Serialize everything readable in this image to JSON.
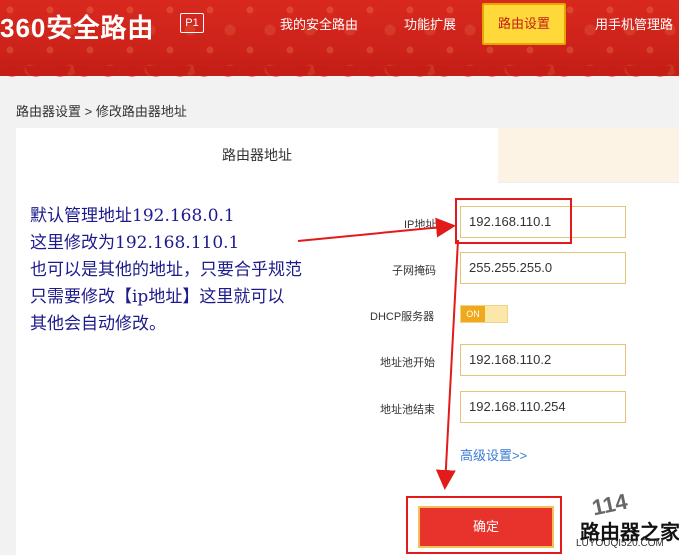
{
  "header": {
    "logo": "360安全路由",
    "badge": "P1",
    "nav": [
      "我的安全路由",
      "功能扩展",
      "路由设置",
      "用手机管理路"
    ],
    "active_index": 2
  },
  "breadcrumb": "路由器设置 > 修改路由器地址",
  "tab": {
    "title": "路由器地址"
  },
  "annotation": {
    "lines": [
      "默认管理地址192.168.0.1",
      "这里修改为192.168.110.1",
      "也可以是其他的地址，只要合乎规范",
      "只需要修改【ip地址】这里就可以",
      "其他会自动修改。"
    ],
    "color": "#1d1a8c"
  },
  "form": {
    "ip_label": "IP地址",
    "ip_value": "192.168.110.1",
    "mask_label": "子网掩码",
    "mask_value": "255.255.255.0",
    "dhcp_label": "DHCP服务器",
    "dhcp_state": "ON",
    "pool_start_label": "地址池开始",
    "pool_start_value": "192.168.110.2",
    "pool_end_label": "地址池结束",
    "pool_end_value": "192.168.110.254",
    "advanced_link": "高级设置>>",
    "confirm_label": "确定"
  },
  "watermark": {
    "line1": "114",
    "line2": "路由器之家",
    "line3": "LUYOUQI520.COM"
  },
  "colors": {
    "brand_red": "#c41e16",
    "highlight_box": "#e21a1a",
    "active_tab_yellow": "#ffd93a"
  }
}
